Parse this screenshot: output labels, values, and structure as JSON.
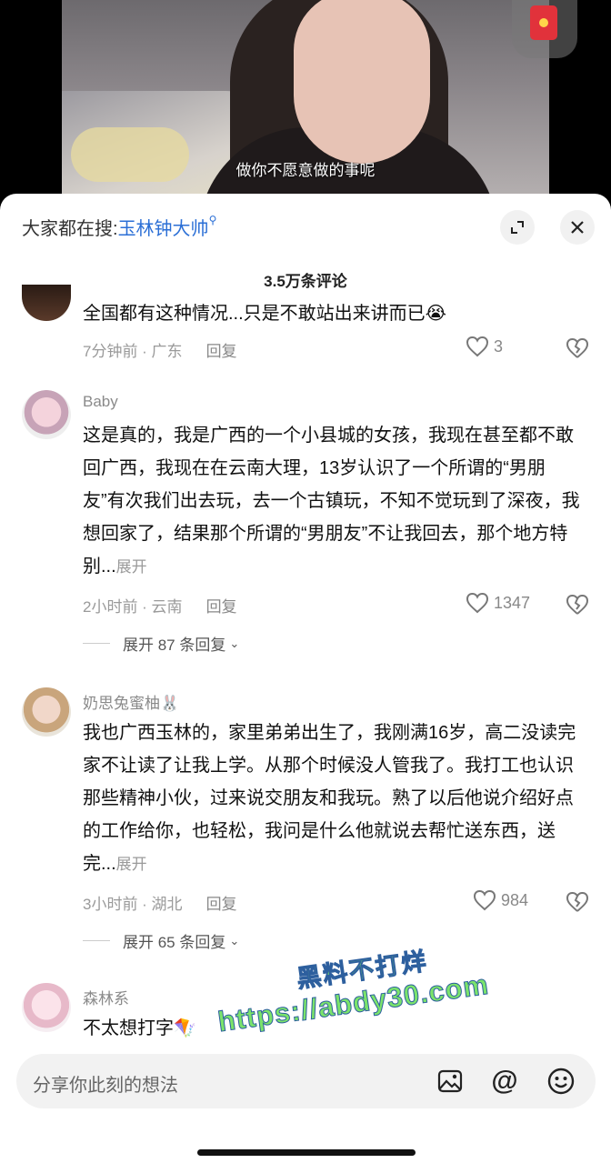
{
  "video": {
    "subtitle": "做你不愿意做的事呢"
  },
  "header": {
    "search_prefix": "大家都在搜:",
    "search_keyword": "玉林钟大帅",
    "comment_count": "3.5万条评论"
  },
  "comments": [
    {
      "name": "",
      "text": "全国都有这种情况...只是不敢站出来讲而已😭",
      "time_loc": "7分钟前 · 广东",
      "reply": "回复",
      "likes": "3"
    },
    {
      "name": "Baby",
      "text": "这是真的，我是广西的一个小县城的女孩，我现在甚至都不敢回广西，我现在在云南大理，13岁认识了一个所谓的“男朋友”有次我们出去玩，去一个古镇玩，不知不觉玩到了深夜，我想回家了，结果那个所谓的“男朋友”不让我回去，那个地方特别...",
      "expand": "展开",
      "time_loc": "2小时前 · 云南",
      "reply": "回复",
      "likes": "1347",
      "more": "展开 87 条回复"
    },
    {
      "name": "奶思兔蜜柚🐰",
      "text": "我也广西玉林的，家里弟弟出生了，我刚满16岁，高二没读完家不让读了让我上学。从那个时候没人管我了。我打工也认识那些精神小伙，过来说交朋友和我玩。熟了以后他说介绍好点的工作给你，也轻松，我问是什么他就说去帮忙送东西，送完...",
      "expand": "展开",
      "time_loc": "3小时前 · 湖北",
      "reply": "回复",
      "likes": "984",
      "more": "展开 65 条回复"
    },
    {
      "name": "森林系",
      "text": "不太想打字🪁"
    }
  ],
  "input": {
    "placeholder": "分享你此刻的想法"
  },
  "watermark": {
    "line1": "黑料不打烊",
    "line2": "https://abdy30.com"
  },
  "colors": {
    "accent": "#2b6fd6",
    "watermark": "#7be36b"
  }
}
